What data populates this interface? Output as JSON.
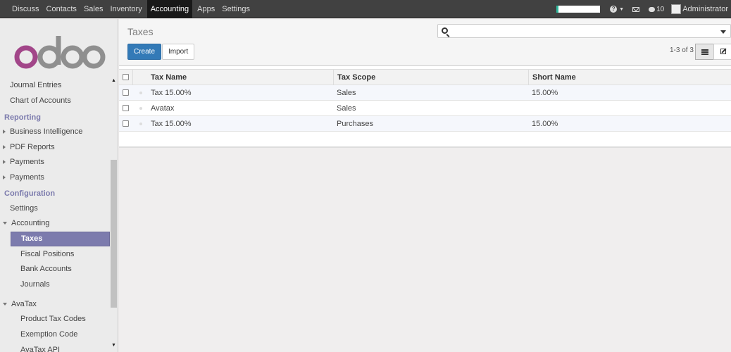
{
  "topbar": {
    "menu": [
      "Discuss",
      "Contacts",
      "Sales",
      "Inventory",
      "Accounting",
      "Apps",
      "Settings"
    ],
    "active": "Accounting",
    "message_count": "10",
    "user": "Administrator"
  },
  "sidebar": {
    "logo_text": "odoo",
    "items": {
      "journal_entries": "Journal Entries",
      "chart_of_accounts": "Chart of Accounts",
      "reporting": "Reporting",
      "business_intelligence": "Business Intelligence",
      "pdf_reports": "PDF Reports",
      "payments_1": "Payments",
      "payments_2": "Payments",
      "configuration": "Configuration",
      "settings": "Settings",
      "accounting": "Accounting",
      "taxes": "Taxes",
      "fiscal_positions": "Fiscal Positions",
      "bank_accounts": "Bank Accounts",
      "journals": "Journals",
      "avatax": "AvaTax",
      "product_tax_codes": "Product Tax Codes",
      "exemption_code": "Exemption Code",
      "avatax_api": "AvaTax API"
    }
  },
  "header": {
    "title": "Taxes",
    "create_label": "Create",
    "import_label": "Import",
    "pager": "1-3 of 3",
    "search_value": ""
  },
  "table": {
    "columns": [
      "Tax Name",
      "Tax Scope",
      "Short Name"
    ],
    "rows": [
      [
        "Tax 15.00%",
        "Sales",
        "15.00%"
      ],
      [
        "Avatax",
        "Sales",
        ""
      ],
      [
        "Tax 15.00%",
        "Purchases",
        "15.00%"
      ]
    ]
  },
  "colors": {
    "accent": "#7c7bad",
    "primary": "#337ab7",
    "topbar": "#414141"
  }
}
